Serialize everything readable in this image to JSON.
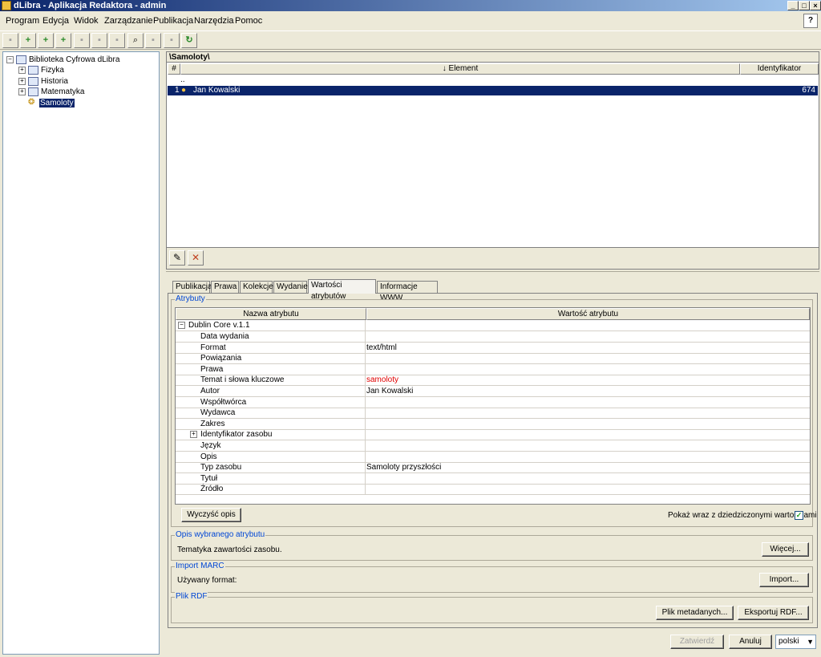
{
  "window": {
    "title": "dLibra - Aplikacja Redaktora - admin"
  },
  "menu": [
    "Program",
    "Edycja",
    "Widok",
    "Zarządzanie",
    "Publikacja",
    "Narzędzia",
    "Pomoc"
  ],
  "tree": {
    "root": "Biblioteka Cyfrowa dLibra",
    "items": [
      "Fizyka",
      "Historia",
      "Matematyka",
      "Samoloty"
    ]
  },
  "list": {
    "path": "\\Samoloty\\",
    "headers": {
      "num": "#",
      "element": "↓ Element",
      "id": "Identyfikator"
    },
    "parent_row": "..",
    "rows": [
      {
        "num": "1",
        "element": "Jan Kowalski",
        "id": "674"
      }
    ]
  },
  "tabs": [
    "Publikacja",
    "Prawa",
    "Kolekcje",
    "Wydanie",
    "Wartości atrybutów",
    "Informacje WWW"
  ],
  "attributes": {
    "group_title": "Atrybuty",
    "col_name": "Nazwa atrybutu",
    "col_value": "Wartość atrybutu",
    "root": "Dublin Core v.1.1",
    "rows": [
      {
        "name": "Data wydania",
        "value": ""
      },
      {
        "name": "Format",
        "value": "text/html"
      },
      {
        "name": "Powiązania",
        "value": ""
      },
      {
        "name": "Prawa",
        "value": ""
      },
      {
        "name": "Temat i słowa kluczowe",
        "value": "samoloty"
      },
      {
        "name": "Autor",
        "value": "Jan Kowalski"
      },
      {
        "name": "Współtwórca",
        "value": ""
      },
      {
        "name": "Wydawca",
        "value": ""
      },
      {
        "name": "Zakres",
        "value": ""
      },
      {
        "name": "Identyfikator zasobu",
        "value": ""
      },
      {
        "name": "Język",
        "value": ""
      },
      {
        "name": "Opis",
        "value": ""
      },
      {
        "name": "Typ zasobu",
        "value": "Samoloty przyszłości"
      },
      {
        "name": "Tytuł",
        "value": ""
      },
      {
        "name": "Źródło",
        "value": ""
      }
    ],
    "clear_button": "Wyczyść opis",
    "inherited_label": "Pokaż wraz z dziedziczonymi wartościami",
    "inherited_checked": true,
    "highlight_color": "#e00000"
  },
  "description": {
    "title": "Opis wybranego atrybutu",
    "text": "Tematyka zawartości zasobu.",
    "more_button": "Więcej..."
  },
  "marc": {
    "title": "Import MARC",
    "label": "Używany format:",
    "import_button": "Import..."
  },
  "rdf": {
    "title": "Plik RDF",
    "metadata_button": "Plik metadanych...",
    "export_button": "Eksportuj RDF..."
  },
  "footer": {
    "confirm": "Zatwierdź",
    "cancel": "Anuluj",
    "language": "polski"
  }
}
